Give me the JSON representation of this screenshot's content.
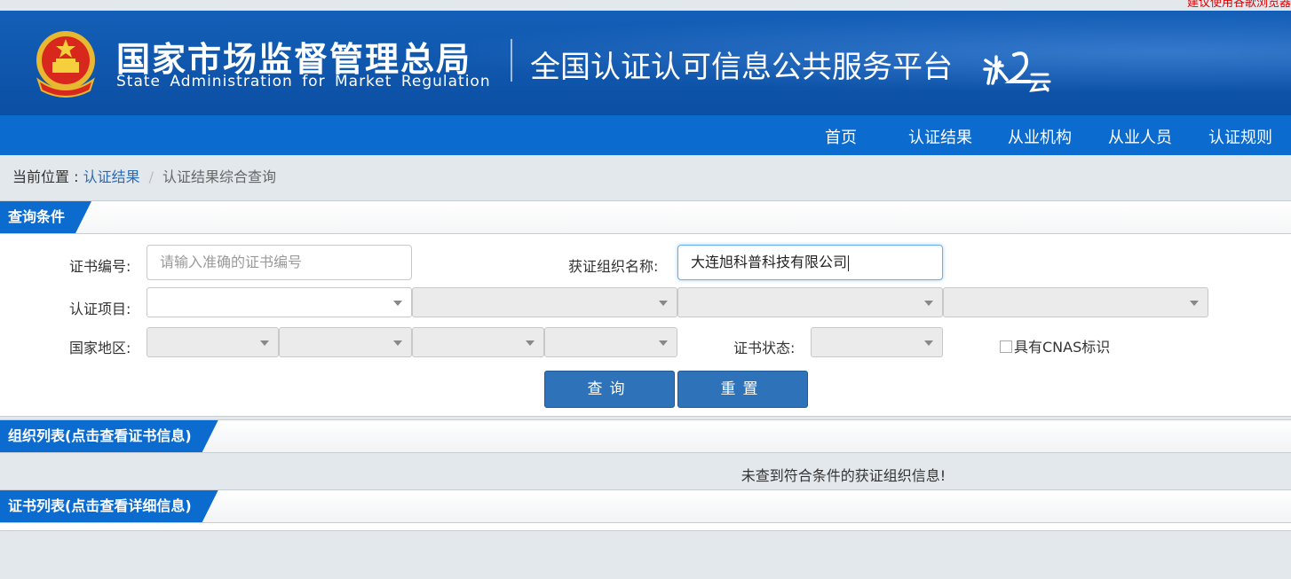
{
  "top_notice": "建议使用谷歌浏览器",
  "header": {
    "agency_cn": "国家市场监督管理总局",
    "agency_en": "State Administration for Market Regulation",
    "platform": "全国认证认可信息公共服务平台"
  },
  "nav": [
    "首页",
    "认证结果",
    "从业机构",
    "从业人员",
    "认证规则"
  ],
  "breadcrumb": {
    "prefix": "当前位置 : ",
    "link": "认证结果",
    "separator": "/",
    "current": "认证结果综合查询"
  },
  "query": {
    "section_title": "查询条件",
    "cert_no_label": "证书编号:",
    "cert_no_placeholder": "请输入准确的证书编号",
    "org_name_label": "获证组织名称:",
    "org_name_value": "大连旭科普科技有限公司",
    "project_label": "认证项目:",
    "region_label": "国家地区:",
    "status_label": "证书状态:",
    "cnas_label": "具有CNAS标识",
    "search_button": "查询",
    "reset_button": "重置"
  },
  "org_list": {
    "title": "组织列表(点击查看证书信息)",
    "empty_message": "未查到符合条件的获证组织信息!"
  },
  "cert_list": {
    "title": "证书列表(点击查看详细信息)"
  },
  "colors": {
    "header_bg": "#0e5cb6",
    "nav_bg": "#0b6bce",
    "button_bg": "#2e73b9",
    "link": "#2a6bb5"
  }
}
